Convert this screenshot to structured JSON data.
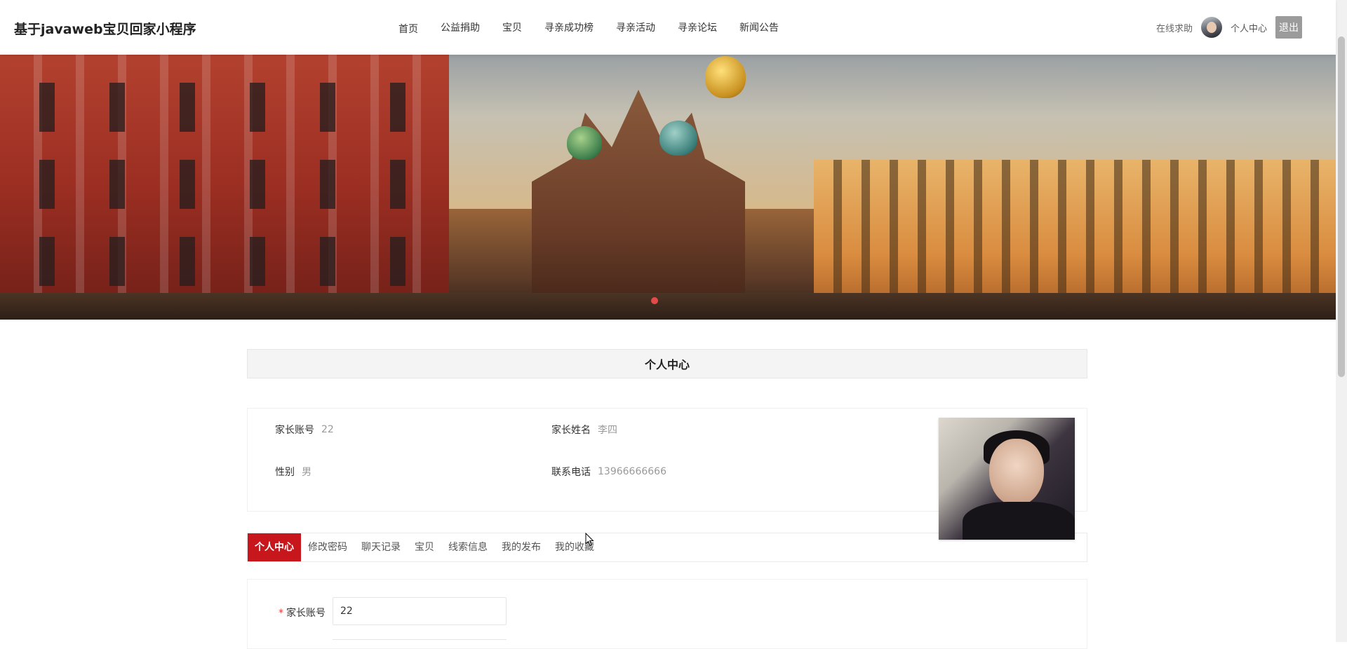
{
  "header": {
    "brand": "基于javaweb宝贝回家小程序",
    "nav": [
      "首页",
      "公益捐助",
      "宝贝",
      "寻亲成功榜",
      "寻亲活动",
      "寻亲论坛",
      "新闻公告"
    ],
    "help_link": "在线求助",
    "user_center": "个人中心",
    "logout": "退出"
  },
  "section": {
    "title": "个人中心"
  },
  "profile": {
    "account_label": "家长账号",
    "account_value": "22",
    "name_label": "家长姓名",
    "name_value": "李四",
    "gender_label": "性别",
    "gender_value": "男",
    "phone_label": "联系电话",
    "phone_value": "13966666666"
  },
  "tabs": [
    "个人中心",
    "修改密码",
    "聊天记录",
    "宝贝",
    "线索信息",
    "我的发布",
    "我的收藏"
  ],
  "form": {
    "required_mark": "*",
    "account_label": "家长账号",
    "account_value": "22"
  },
  "colors": {
    "accent": "#c8161d",
    "logout_bg": "#9b9b9b",
    "banner_dot": "#e34b4b"
  }
}
